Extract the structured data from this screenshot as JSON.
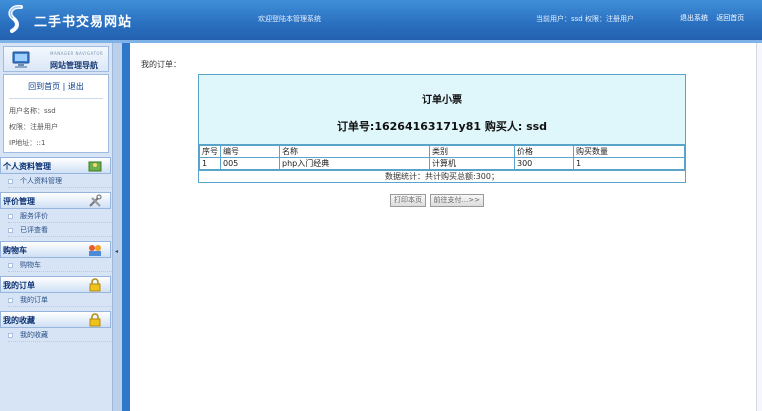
{
  "header": {
    "title": "二手书交易网站",
    "welcome": "欢迎登陆本管理系统",
    "current_user": "当前用户：ssd 权限：注册用户",
    "logout": "退出系统",
    "home": "返回首页"
  },
  "sidebar": {
    "nav_title_en": "MANAGER NAVIGATOR",
    "nav_title": "网站管理导航",
    "home_link": "回到首页",
    "separator": "|",
    "exit_link": "退出",
    "user_name": "用户名称：ssd",
    "role": "权限：注册用户",
    "ip": "IP地址：::1",
    "groups": [
      {
        "title": "个人资料管理",
        "items": [
          "个人资料管理"
        ]
      },
      {
        "title": "评价管理",
        "items": [
          "服务评价",
          "已评查看"
        ]
      },
      {
        "title": "购物车",
        "items": [
          "购物车"
        ]
      },
      {
        "title": "我的订单",
        "items": [
          "我的订单"
        ]
      },
      {
        "title": "我的收藏",
        "items": [
          "我的收藏"
        ]
      }
    ]
  },
  "main": {
    "breadcrumb": "我的订单：",
    "ticket_title": "订单小票",
    "ticket_sub": "订单号:16264163171y81 购买人: ssd",
    "columns": [
      "序号",
      "编号",
      "名称",
      "类别",
      "价格",
      "购买数量"
    ],
    "rows": [
      [
        "1",
        "005",
        "php入门经典",
        "计算机",
        "300",
        "1"
      ]
    ],
    "summary": "数据统计：共计购买总额:300；",
    "print_button": "打印本页",
    "pay_button": "前往支付...>>"
  },
  "colors": {
    "header_blue": "#2a6fc0",
    "ticket_head_bg": "#dff6fb",
    "table_border": "#5aa3c9"
  }
}
